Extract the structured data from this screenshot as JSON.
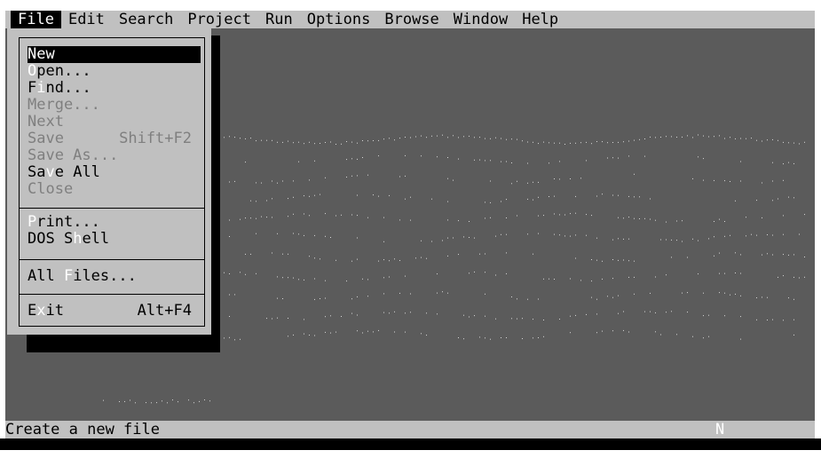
{
  "menubar": {
    "items": [
      {
        "label": "File"
      },
      {
        "label": "Edit"
      },
      {
        "label": "Search"
      },
      {
        "label": "Project"
      },
      {
        "label": "Run"
      },
      {
        "label": "Options"
      },
      {
        "label": "Browse"
      },
      {
        "label": "Window"
      },
      {
        "label": "Help"
      }
    ]
  },
  "file_menu": {
    "group1": [
      {
        "pre": "",
        "hk": "",
        "post": "New",
        "shortcut": ""
      },
      {
        "pre": "",
        "hk": "O",
        "post": "pen...",
        "shortcut": ""
      },
      {
        "pre": "F",
        "hk": "i",
        "post": "nd...",
        "shortcut": ""
      },
      {
        "pre": "Merge...",
        "hk": "",
        "post": "",
        "shortcut": ""
      },
      {
        "pre": "Next",
        "hk": "",
        "post": "",
        "shortcut": ""
      },
      {
        "pre": "Save",
        "hk": "",
        "post": "",
        "shortcut": "Shift+F2"
      },
      {
        "pre": "Save As...",
        "hk": "",
        "post": "",
        "shortcut": ""
      },
      {
        "pre": "Sa",
        "hk": "v",
        "post": "e All",
        "shortcut": ""
      },
      {
        "pre": "Close",
        "hk": "",
        "post": "",
        "shortcut": ""
      }
    ],
    "group2": [
      {
        "pre": "",
        "hk": "P",
        "post": "rint...",
        "shortcut": ""
      },
      {
        "pre": "DOS S",
        "hk": "h",
        "post": "ell",
        "shortcut": ""
      }
    ],
    "group3": [
      {
        "pre": "All ",
        "hk": "F",
        "post": "iles...",
        "shortcut": ""
      }
    ],
    "group4": [
      {
        "pre": "E",
        "hk": "x",
        "post": "it",
        "shortcut": "Alt+F4"
      }
    ]
  },
  "status": {
    "message": "Create a new file",
    "indicator": "N"
  },
  "colors": {
    "menubar_bg": "#c0c0c0",
    "desktop_bg": "#5b5b5b",
    "highlight": "#000000",
    "disabled_text": "#7f7f7f",
    "hotkey": "#ffffff"
  }
}
